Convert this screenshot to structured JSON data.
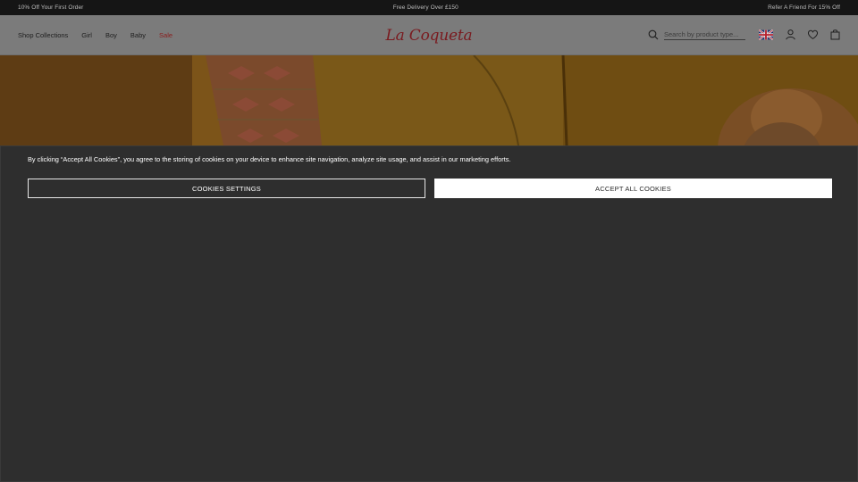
{
  "promo_bar": {
    "left": "10% Off Your First Order",
    "center": "Free Delivery Over £150",
    "right": "Refer A Friend For 15% Off"
  },
  "nav": {
    "items": [
      {
        "label": "Shop Collections"
      },
      {
        "label": "Girl"
      },
      {
        "label": "Boy"
      },
      {
        "label": "Baby"
      },
      {
        "label": "Sale"
      }
    ]
  },
  "logo": {
    "text": "La Coqueta"
  },
  "search": {
    "placeholder": "Search by product type..."
  },
  "header_icons": [
    "search-icon",
    "uk-flag-icon",
    "account-icon",
    "wishlist-heart-icon",
    "shopping-bag-icon"
  ],
  "colors": {
    "promo_bg": "#151515",
    "header_bg": "#7b7b7b",
    "logo": "#7a1a1f",
    "sale": "#8a1c1c",
    "overlay": "#2e2e2e"
  },
  "cookie_banner": {
    "message": "By clicking “Accept All Cookies”, you agree to the storing of cookies on your device to enhance site navigation, analyze site usage, and assist in our marketing efforts.",
    "settings_label": "COOKIES SETTINGS",
    "accept_label": "ACCEPT ALL COOKIES"
  }
}
